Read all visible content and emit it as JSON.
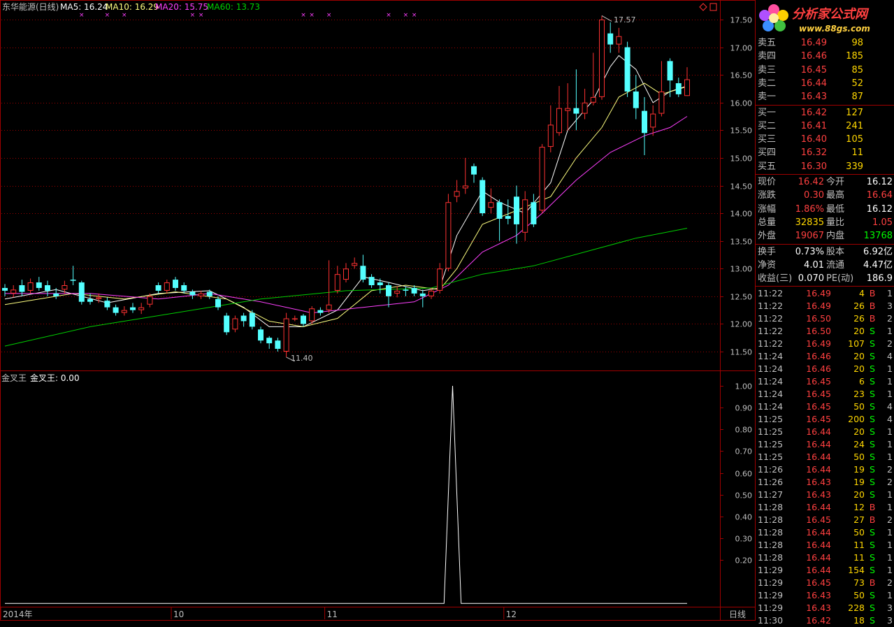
{
  "header": {
    "stock_title": "东华能源(日线)",
    "ma5": "MA5: 16.24",
    "ma10": "MA10: 16.29",
    "ma20": "MA20: 15.75",
    "ma60": "MA60: 13.73",
    "indicator_title": "金叉王",
    "indicator_value": "金叉王: 0.00",
    "period_label": "日线",
    "high_label": "17.57",
    "low_label": "11.40"
  },
  "colors": {
    "up": "#ff3232",
    "down": "#54ffff",
    "ma5": "#ffffff",
    "ma10": "#ffff80",
    "ma20": "#ff40ff",
    "ma60": "#00d000",
    "grid": "#a00000"
  },
  "logo": {
    "name": "分析家公式网",
    "url": "www.88gs.com"
  },
  "chart_data": [
    {
      "type": "candlestick",
      "title": "东华能源(日线)",
      "y_ticks": [
        "17.50",
        "17.00",
        "16.50",
        "16.00",
        "15.50",
        "15.00",
        "14.50",
        "14.00",
        "13.50",
        "13.00",
        "12.50",
        "12.00",
        "11.50"
      ],
      "ylim": [
        11.2,
        17.8
      ],
      "x_ticks": [
        {
          "label": "2014年",
          "index": 0
        },
        {
          "label": "10",
          "index": 20
        },
        {
          "label": "11",
          "index": 38
        },
        {
          "label": "12",
          "index": 59
        }
      ],
      "candles": [
        [
          12.65,
          12.6,
          12.72,
          12.5
        ],
        [
          12.55,
          12.62,
          12.7,
          12.48
        ],
        [
          12.7,
          12.58,
          12.8,
          12.5
        ],
        [
          12.6,
          12.75,
          12.82,
          12.55
        ],
        [
          12.75,
          12.65,
          12.85,
          12.6
        ],
        [
          12.7,
          12.6,
          12.78,
          12.5
        ],
        [
          12.55,
          12.5,
          12.65,
          12.45
        ],
        [
          12.62,
          12.7,
          12.78,
          12.55
        ],
        [
          12.8,
          12.78,
          13.05,
          12.7
        ],
        [
          12.75,
          12.4,
          12.78,
          12.35
        ],
        [
          12.45,
          12.4,
          12.55,
          12.35
        ],
        [
          12.45,
          12.48,
          12.55,
          12.38
        ],
        [
          12.42,
          12.3,
          12.48,
          12.25
        ],
        [
          12.3,
          12.2,
          12.35,
          12.15
        ],
        [
          12.2,
          12.25,
          12.32,
          12.15
        ],
        [
          12.3,
          12.25,
          12.38,
          12.2
        ],
        [
          12.25,
          12.3,
          12.38,
          12.18
        ],
        [
          12.35,
          12.5,
          12.55,
          12.3
        ],
        [
          12.7,
          12.6,
          12.75,
          12.55
        ],
        [
          12.6,
          12.75,
          12.8,
          12.55
        ],
        [
          12.8,
          12.65,
          12.85,
          12.6
        ],
        [
          12.7,
          12.6,
          12.75,
          12.55
        ],
        [
          12.58,
          12.52,
          12.62,
          12.45
        ],
        [
          12.5,
          12.55,
          12.6,
          12.45
        ],
        [
          12.58,
          12.5,
          12.62,
          12.45
        ],
        [
          12.45,
          12.3,
          12.5,
          12.25
        ],
        [
          12.15,
          11.85,
          12.2,
          11.8
        ],
        [
          11.9,
          12.1,
          12.15,
          11.85
        ],
        [
          12.15,
          12.05,
          12.2,
          11.95
        ],
        [
          12.2,
          11.95,
          12.25,
          11.9
        ],
        [
          11.9,
          11.7,
          11.95,
          11.65
        ],
        [
          11.75,
          11.65,
          11.78,
          11.55
        ],
        [
          11.7,
          11.55,
          11.75,
          11.5
        ],
        [
          11.5,
          12.1,
          12.2,
          11.4
        ],
        [
          12.1,
          12.1,
          12.15,
          12.05
        ],
        [
          12.15,
          12.0,
          12.18,
          11.95
        ],
        [
          12.05,
          12.28,
          12.32,
          12.0
        ],
        [
          12.25,
          12.2,
          12.3,
          12.15
        ],
        [
          12.25,
          12.35,
          13.15,
          12.2
        ],
        [
          12.6,
          12.9,
          13.05,
          12.55
        ],
        [
          12.8,
          13.0,
          13.1,
          12.75
        ],
        [
          13.05,
          13.1,
          13.2,
          13.0
        ],
        [
          13.05,
          12.8,
          13.25,
          12.75
        ],
        [
          12.85,
          12.7,
          12.9,
          12.65
        ],
        [
          12.75,
          12.7,
          12.82,
          12.55
        ],
        [
          12.7,
          12.5,
          12.75,
          12.3
        ],
        [
          12.55,
          12.6,
          12.68,
          12.48
        ],
        [
          12.62,
          12.6,
          12.68,
          12.5
        ],
        [
          12.65,
          12.55,
          12.7,
          12.5
        ],
        [
          12.55,
          12.5,
          12.62,
          12.3
        ],
        [
          12.5,
          12.6,
          12.65,
          12.45
        ],
        [
          12.6,
          13.0,
          13.1,
          12.55
        ],
        [
          13.0,
          14.2,
          14.35,
          12.95
        ],
        [
          14.3,
          14.4,
          14.6,
          14.2
        ],
        [
          14.45,
          14.5,
          15.0,
          14.35
        ],
        [
          14.85,
          14.7,
          14.9,
          14.55
        ],
        [
          14.6,
          14.0,
          14.65,
          13.95
        ],
        [
          14.1,
          14.2,
          14.45,
          14.0
        ],
        [
          14.2,
          13.9,
          14.25,
          13.5
        ],
        [
          13.95,
          13.9,
          14.25,
          13.8
        ],
        [
          14.3,
          13.8,
          14.5,
          13.45
        ],
        [
          13.65,
          14.25,
          14.4,
          13.5
        ],
        [
          14.2,
          13.8,
          14.35,
          13.75
        ],
        [
          14.05,
          15.2,
          15.25,
          14.0
        ],
        [
          15.2,
          15.6,
          15.95,
          15.1
        ],
        [
          15.45,
          15.9,
          16.3,
          15.4
        ],
        [
          15.85,
          15.9,
          16.35,
          15.5
        ],
        [
          15.9,
          15.8,
          16.6,
          15.5
        ],
        [
          15.8,
          16.0,
          16.25,
          15.7
        ],
        [
          16.0,
          16.1,
          16.9,
          15.95
        ],
        [
          16.1,
          17.5,
          17.57,
          16.05
        ],
        [
          17.25,
          17.05,
          17.45,
          16.9
        ],
        [
          17.05,
          17.2,
          17.35,
          16.9
        ],
        [
          17.0,
          16.2,
          17.1,
          16.1
        ],
        [
          16.2,
          15.9,
          16.5,
          15.7
        ],
        [
          15.85,
          15.45,
          16.1,
          15.05
        ],
        [
          15.55,
          15.8,
          15.95,
          15.4
        ],
        [
          15.8,
          16.2,
          16.75,
          15.75
        ],
        [
          16.75,
          16.4,
          16.8,
          16.1
        ],
        [
          16.35,
          16.15,
          16.45,
          16.1
        ],
        [
          16.12,
          16.42,
          16.64,
          16.12
        ]
      ],
      "ma_series": [
        {
          "name": "MA5",
          "color": "#ffffff",
          "values": [
            [
              0,
              12.45
            ],
            [
              6,
              12.62
            ],
            [
              12,
              12.38
            ],
            [
              18,
              12.55
            ],
            [
              24,
              12.6
            ],
            [
              28,
              12.3
            ],
            [
              31,
              11.95
            ],
            [
              35,
              11.95
            ],
            [
              39,
              12.25
            ],
            [
              42,
              12.85
            ],
            [
              45,
              12.75
            ],
            [
              49,
              12.6
            ],
            [
              51,
              12.65
            ],
            [
              53,
              13.6
            ],
            [
              56,
              14.4
            ],
            [
              58,
              14.2
            ],
            [
              61,
              14.0
            ],
            [
              64,
              14.55
            ],
            [
              66,
              15.5
            ],
            [
              69,
              16.05
            ],
            [
              71,
              16.65
            ],
            [
              72,
              16.85
            ],
            [
              74,
              16.6
            ],
            [
              76,
              16.0
            ],
            [
              78,
              16.2
            ],
            [
              80,
              16.3
            ]
          ]
        },
        {
          "name": "MA10",
          "color": "#ffff80",
          "values": [
            [
              0,
              12.35
            ],
            [
              8,
              12.55
            ],
            [
              14,
              12.45
            ],
            [
              20,
              12.58
            ],
            [
              26,
              12.45
            ],
            [
              31,
              12.05
            ],
            [
              35,
              11.95
            ],
            [
              39,
              12.1
            ],
            [
              43,
              12.6
            ],
            [
              47,
              12.7
            ],
            [
              51,
              12.62
            ],
            [
              53,
              13.0
            ],
            [
              56,
              13.8
            ],
            [
              60,
              14.05
            ],
            [
              64,
              14.3
            ],
            [
              67,
              15.0
            ],
            [
              70,
              15.55
            ],
            [
              72,
              16.1
            ],
            [
              75,
              16.35
            ],
            [
              77,
              16.15
            ],
            [
              80,
              16.29
            ]
          ]
        },
        {
          "name": "MA20",
          "color": "#ff40ff",
          "values": [
            [
              0,
              12.55
            ],
            [
              10,
              12.55
            ],
            [
              18,
              12.45
            ],
            [
              24,
              12.55
            ],
            [
              30,
              12.4
            ],
            [
              36,
              12.2
            ],
            [
              42,
              12.3
            ],
            [
              48,
              12.4
            ],
            [
              52,
              12.7
            ],
            [
              56,
              13.3
            ],
            [
              60,
              13.6
            ],
            [
              63,
              14.0
            ],
            [
              67,
              14.6
            ],
            [
              71,
              15.1
            ],
            [
              75,
              15.4
            ],
            [
              78,
              15.55
            ],
            [
              80,
              15.75
            ]
          ]
        },
        {
          "name": "MA60",
          "color": "#00d000",
          "values": [
            [
              0,
              11.6
            ],
            [
              10,
              11.95
            ],
            [
              20,
              12.2
            ],
            [
              30,
              12.45
            ],
            [
              40,
              12.6
            ],
            [
              50,
              12.65
            ],
            [
              56,
              12.9
            ],
            [
              62,
              13.05
            ],
            [
              68,
              13.3
            ],
            [
              74,
              13.55
            ],
            [
              80,
              13.73
            ]
          ]
        }
      ],
      "signals": [
        9,
        12,
        14,
        22,
        23,
        35,
        36,
        38,
        45,
        47,
        48
      ]
    },
    {
      "type": "line",
      "title": "金叉王",
      "y_ticks": [
        "1.00",
        "0.90",
        "0.80",
        "0.70",
        "0.60",
        "0.50",
        "0.40",
        "0.30",
        "0.20"
      ],
      "ylim": [
        0,
        1.03
      ],
      "values": [
        [
          0,
          0
        ],
        [
          51.5,
          0
        ],
        [
          52.5,
          1
        ],
        [
          53.5,
          0
        ],
        [
          80,
          0
        ]
      ]
    }
  ],
  "order_book": {
    "sell": [
      {
        "label": "卖五",
        "price": "16.49",
        "vol": "98"
      },
      {
        "label": "卖四",
        "price": "16.46",
        "vol": "185"
      },
      {
        "label": "卖三",
        "price": "16.45",
        "vol": "85"
      },
      {
        "label": "卖二",
        "price": "16.44",
        "vol": "52"
      },
      {
        "label": "卖一",
        "price": "16.43",
        "vol": "87"
      }
    ],
    "buy": [
      {
        "label": "买一",
        "price": "16.42",
        "vol": "127"
      },
      {
        "label": "买二",
        "price": "16.41",
        "vol": "241"
      },
      {
        "label": "买三",
        "price": "16.40",
        "vol": "105"
      },
      {
        "label": "买四",
        "price": "16.32",
        "vol": "11"
      },
      {
        "label": "买五",
        "price": "16.30",
        "vol": "339"
      }
    ]
  },
  "quote": [
    {
      "l1": "现价",
      "v1": "16.42",
      "c1": "#ff4040",
      "l2": "今开",
      "v2": "16.12",
      "c2": "#ffffff"
    },
    {
      "l1": "涨跌",
      "v1": "0.30",
      "c1": "#ff4040",
      "l2": "最高",
      "v2": "16.64",
      "c2": "#ff4040"
    },
    {
      "l1": "涨幅",
      "v1": "1.86%",
      "c1": "#ff4040",
      "l2": "最低",
      "v2": "16.12",
      "c2": "#ffffff"
    },
    {
      "l1": "总量",
      "v1": "32835",
      "c1": "#ffd700",
      "l2": "量比",
      "v2": "1.05",
      "c2": "#ff4040"
    },
    {
      "l1": "外盘",
      "v1": "19067",
      "c1": "#ff4040",
      "l2": "内盘",
      "v2": "13768",
      "c2": "#00ff00"
    }
  ],
  "fundamentals": [
    {
      "l1": "换手",
      "v1": "0.73%",
      "l2": "股本",
      "v2": "6.92亿"
    },
    {
      "l1": "净资",
      "v1": "4.01",
      "l2": "流通",
      "v2": "4.47亿"
    },
    {
      "l1": "收益(三)",
      "v1": "0.070",
      "l2": "PE(动)",
      "v2": "186.9"
    }
  ],
  "ticks": [
    [
      "11:22",
      "16.49",
      "4",
      "B",
      "1"
    ],
    [
      "11:22",
      "16.49",
      "26",
      "B",
      "3"
    ],
    [
      "11:22",
      "16.50",
      "26",
      "B",
      "2"
    ],
    [
      "11:22",
      "16.50",
      "20",
      "S",
      "1"
    ],
    [
      "11:22",
      "16.49",
      "107",
      "S",
      "2"
    ],
    [
      "11:24",
      "16.46",
      "20",
      "S",
      "4"
    ],
    [
      "11:24",
      "16.46",
      "20",
      "S",
      "1"
    ],
    [
      "11:24",
      "16.45",
      "6",
      "S",
      "1"
    ],
    [
      "11:24",
      "16.45",
      "23",
      "S",
      "1"
    ],
    [
      "11:24",
      "16.45",
      "50",
      "S",
      "4"
    ],
    [
      "11:25",
      "16.45",
      "200",
      "S",
      "4"
    ],
    [
      "11:25",
      "16.44",
      "20",
      "S",
      "1"
    ],
    [
      "11:25",
      "16.44",
      "24",
      "S",
      "1"
    ],
    [
      "11:25",
      "16.44",
      "50",
      "S",
      "1"
    ],
    [
      "11:26",
      "16.44",
      "19",
      "S",
      "2"
    ],
    [
      "11:26",
      "16.43",
      "19",
      "S",
      "2"
    ],
    [
      "11:27",
      "16.43",
      "20",
      "S",
      "1"
    ],
    [
      "11:28",
      "16.44",
      "12",
      "B",
      "1"
    ],
    [
      "11:28",
      "16.45",
      "27",
      "B",
      "2"
    ],
    [
      "11:28",
      "16.44",
      "50",
      "S",
      "1"
    ],
    [
      "11:28",
      "16.44",
      "11",
      "S",
      "1"
    ],
    [
      "11:28",
      "16.44",
      "11",
      "S",
      "1"
    ],
    [
      "11:29",
      "16.44",
      "154",
      "S",
      "1"
    ],
    [
      "11:29",
      "16.45",
      "73",
      "B",
      "2"
    ],
    [
      "11:29",
      "16.43",
      "50",
      "S",
      "1"
    ],
    [
      "11:29",
      "16.43",
      "228",
      "S",
      "3"
    ],
    [
      "11:30",
      "16.42",
      "18",
      "S",
      "3"
    ]
  ]
}
